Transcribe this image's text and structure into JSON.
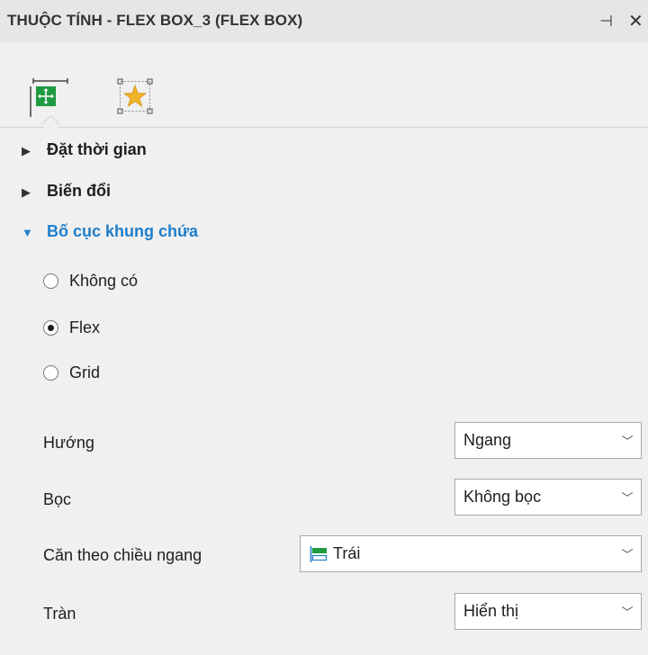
{
  "panel": {
    "title": "THUỘC TÍNH - FLEX BOX_3 (FLEX BOX)",
    "pin_icon": "pin-icon",
    "close_icon": "close-icon",
    "pin_glyph": "⊣",
    "close_glyph": "✕"
  },
  "tabs": [
    {
      "icon": "layout-move-icon",
      "active": true,
      "accent": "#1e9b41"
    },
    {
      "icon": "star-effect-icon",
      "active": false,
      "accent": "#f0b429"
    }
  ],
  "sections": {
    "timing": {
      "label": "Đặt thời gian",
      "arrow": "▶"
    },
    "transform": {
      "label": "Biến đổi",
      "arrow": "▶"
    },
    "container_layout": {
      "label": "Bố cục khung chứa",
      "arrow": "▼"
    }
  },
  "layout_options": {
    "none": "Không có",
    "flex": "Flex",
    "grid": "Grid",
    "selected": "Flex"
  },
  "properties": {
    "direction": {
      "label": "Hướng",
      "value": "Ngang"
    },
    "wrap": {
      "label": "Bọc",
      "value": "Không bọc"
    },
    "align_h": {
      "label": "Căn theo chiều ngang",
      "value": "Trái",
      "icon": "align-left-icon"
    },
    "overflow": {
      "label": "Tràn",
      "value": "Hiển thị"
    }
  },
  "chevron_glyph": "﹀",
  "colors": {
    "accent": "#1f7ec9",
    "tab_green": "#1e9b41",
    "star": "#f0b429"
  }
}
